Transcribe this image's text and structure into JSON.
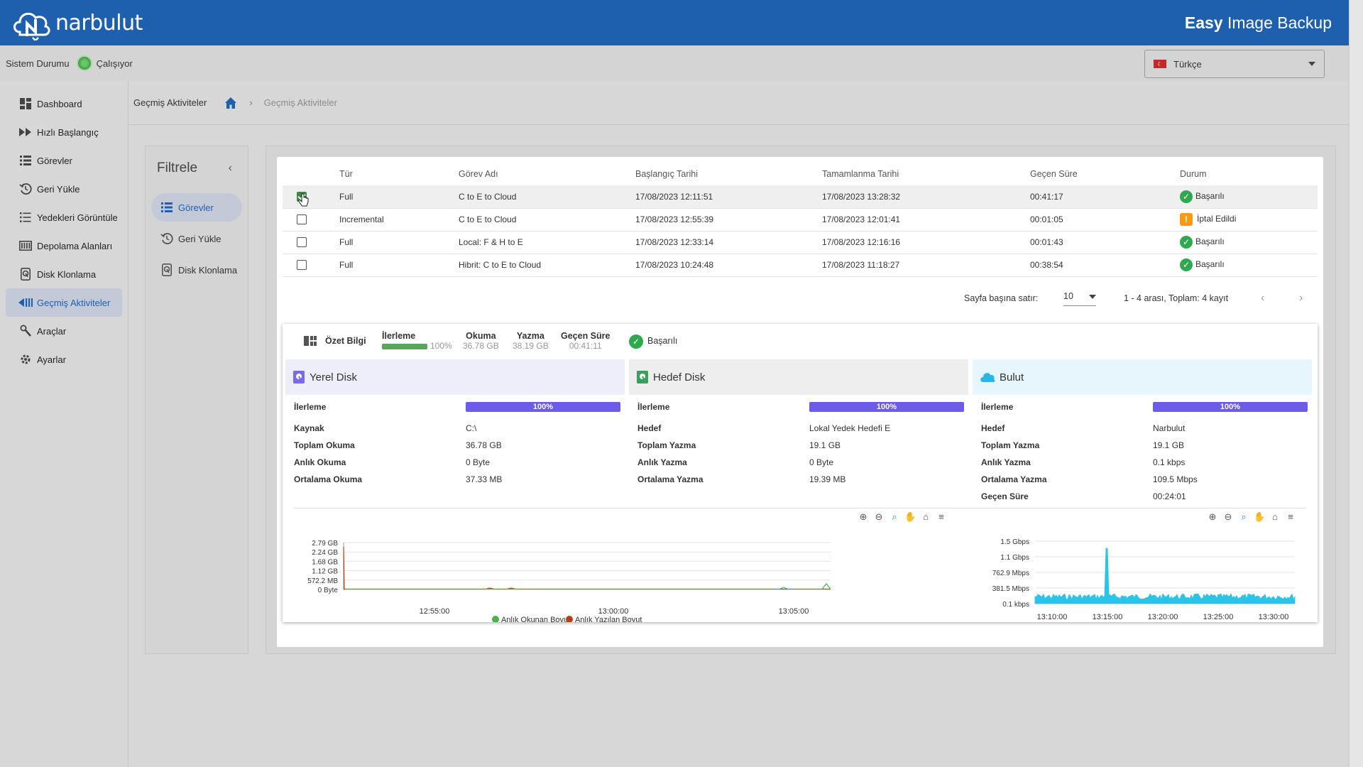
{
  "app": {
    "brand": "narbulut",
    "product_bold": "Easy",
    "product_rest": " Image Backup",
    "accent": "#1e60ae"
  },
  "status": {
    "label": "Sistem Durumu",
    "value": "Çalışıyor",
    "color": "#3e9b3e"
  },
  "language": {
    "selected": "Türkçe"
  },
  "sidebar": {
    "items": [
      {
        "label": "Dashboard",
        "icon": "dashboard-icon"
      },
      {
        "label": "Hızlı Başlangıç",
        "icon": "fast-forward-icon"
      },
      {
        "label": "Görevler",
        "icon": "list-icon"
      },
      {
        "label": "Geri Yükle",
        "icon": "restore-icon"
      },
      {
        "label": "Yedekleri Görüntüle",
        "icon": "list-view-icon"
      },
      {
        "label": "Depolama Alanları",
        "icon": "storage-icon"
      },
      {
        "label": "Disk Klonlama",
        "icon": "disk-icon"
      },
      {
        "label": "Geçmiş Aktiviteler",
        "icon": "history-icon",
        "active": true
      },
      {
        "label": "Araçlar",
        "icon": "tools-icon"
      },
      {
        "label": "Ayarlar",
        "icon": "gear-icon"
      }
    ]
  },
  "breadcrumb": {
    "title": "Geçmiş Aktiviteler",
    "separator": "›",
    "current": "Geçmiş Aktiviteler"
  },
  "filter": {
    "title": "Filtrele",
    "collapse": "‹",
    "items": [
      {
        "label": "Görevler",
        "active": true
      },
      {
        "label": "Geri Yükle"
      },
      {
        "label": "Disk Klonlama"
      }
    ]
  },
  "table": {
    "headers": [
      "Tür",
      "Görev Adı",
      "Başlangıç Tarihi",
      "Tamamlanma Tarihi",
      "Geçen Süre",
      "Durum"
    ],
    "rows": [
      {
        "checked": true,
        "type": "Full",
        "name": "C to E to Cloud",
        "start": "17/08/2023 12:11:51",
        "end": "17/08/2023 13:28:32",
        "elapsed": "00:41:17",
        "status": "Başarılı",
        "status_kind": "ok"
      },
      {
        "checked": false,
        "type": "Incremental",
        "name": "C to E to Cloud",
        "start": "17/08/2023 12:55:39",
        "end": "17/08/2023 12:01:41",
        "elapsed": "00:01:05",
        "status": "İptal Edildi",
        "status_kind": "warn"
      },
      {
        "checked": false,
        "type": "Full",
        "name": "Local: F & H to E",
        "start": "17/08/2023 12:33:14",
        "end": "17/08/2023 12:16:16",
        "elapsed": "00:01:43",
        "status": "Başarılı",
        "status_kind": "ok"
      },
      {
        "checked": false,
        "type": "Full",
        "name": "Hibrit: C to E to Cloud",
        "start": "17/08/2023 10:24:48",
        "end": "17/08/2023 11:18:27",
        "elapsed": "00:38:54",
        "status": "Başarılı",
        "status_kind": "ok"
      }
    ]
  },
  "pager": {
    "rows_label": "Sayfa başına satır:",
    "rows_value": "10",
    "range": "1 - 4 arası, Toplam: 4 kayıt"
  },
  "summary": {
    "label": "Özet Bilgi",
    "progress_label": "İlerleme",
    "progress_value": "100%",
    "progress": 1.0,
    "read_label": "Okuma",
    "read_value": "36.78 GB",
    "write_label": "Yazma",
    "write_value": "38.19 GB",
    "elapsed_label": "Geçen Süre",
    "elapsed_value": "00:41:11",
    "status": "Başarılı"
  },
  "local_disk": {
    "title": "Yerel Disk",
    "progress_label": "İlerleme",
    "progress_value": "100%",
    "rows": [
      {
        "k": "Kaynak",
        "v": "C:\\"
      },
      {
        "k": "Toplam Okuma",
        "v": "36.78 GB"
      },
      {
        "k": "Anlık Okuma",
        "v": "0 Byte"
      },
      {
        "k": "Ortalama Okuma",
        "v": "37.33 MB"
      }
    ]
  },
  "target_disk": {
    "title": "Hedef Disk",
    "progress_label": "İlerleme",
    "progress_value": "100%",
    "rows": [
      {
        "k": "Hedef",
        "v": "Lokal Yedek Hedefi E"
      },
      {
        "k": "Toplam Yazma",
        "v": "19.1 GB"
      },
      {
        "k": "Anlık Yazma",
        "v": "0 Byte"
      },
      {
        "k": "Ortalama Yazma",
        "v": "19.39 MB"
      }
    ]
  },
  "cloud": {
    "title": "Bulut",
    "progress_label": "İlerleme",
    "progress_value": "100%",
    "rows": [
      {
        "k": "Hedef",
        "v": "Narbulut"
      },
      {
        "k": "Toplam Yazma",
        "v": "19.1 GB"
      },
      {
        "k": "Anlık Yazma",
        "v": "0.1 kbps"
      },
      {
        "k": "Ortalama Yazma",
        "v": "109.5 Mbps"
      },
      {
        "k": "Geçen Süre",
        "v": "00:24:01"
      }
    ]
  },
  "chart_data": [
    {
      "type": "line",
      "yticks": [
        "2.79 GB",
        "2.24 GB",
        "1.68 GB",
        "1.12 GB",
        "572.2 MB",
        "0 Byte"
      ],
      "xticks": [
        "12:55:00",
        "13:00:00",
        "13:05:00"
      ],
      "series": [
        {
          "name": "Anlık Okunan Boyut",
          "color": "#4caf50"
        },
        {
          "name": "Anlık Yazılan Boyut",
          "color": "#b5401a"
        }
      ]
    },
    {
      "type": "area",
      "yticks": [
        "1.5 Gbps",
        "1.1 Gbps",
        "762.9 Mbps",
        "381.5 Mbps",
        "0.1 kbps"
      ],
      "xticks": [
        "13:10:00",
        "13:15:00",
        "13:20:00",
        "13:25:00",
        "13:30:00"
      ],
      "series": [
        {
          "color": "#29c4e8"
        }
      ]
    }
  ]
}
